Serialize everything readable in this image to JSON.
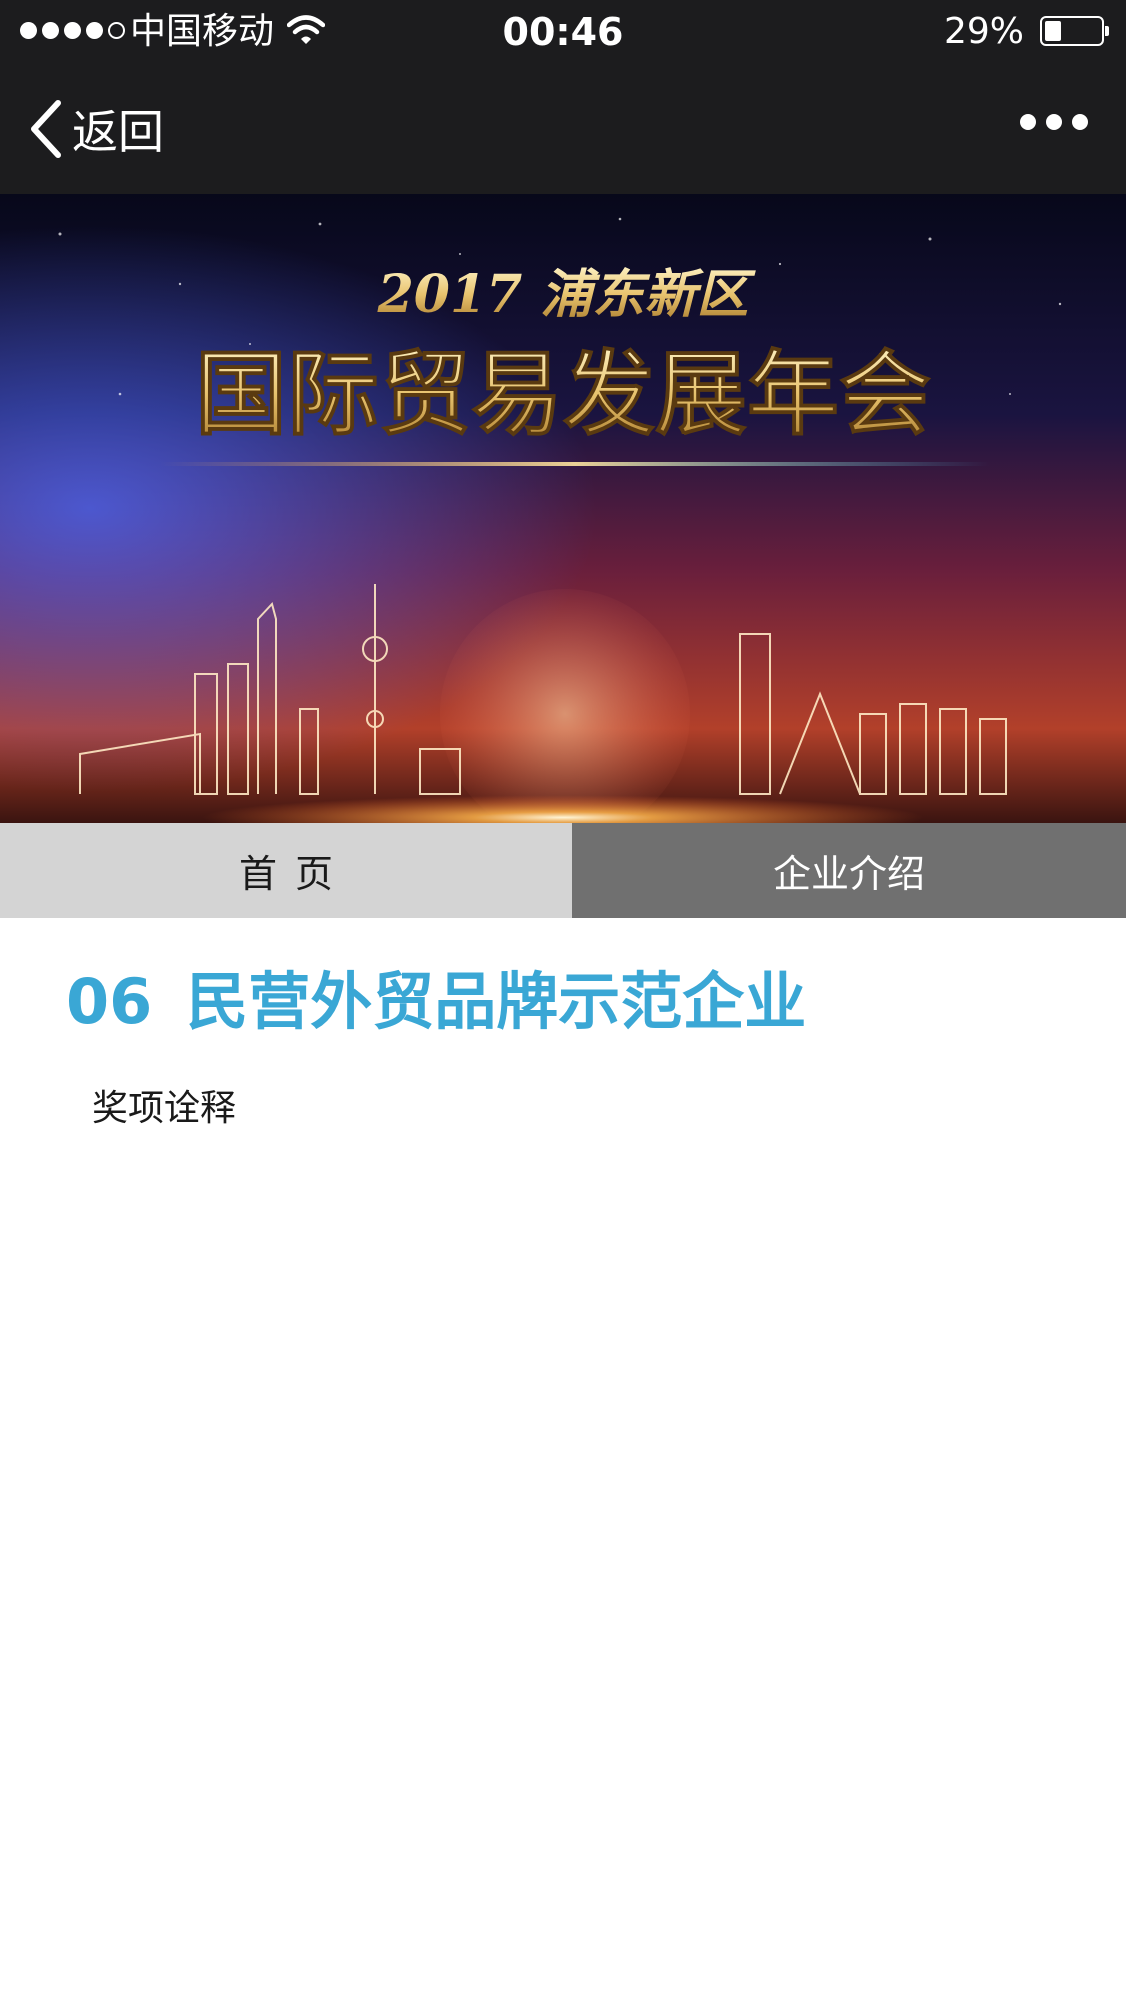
{
  "status_bar": {
    "carrier": "中国移动",
    "time": "00:46",
    "battery_percent": "29%",
    "battery_level": 0.29,
    "signal_bars_filled": 4,
    "signal_bars_total": 5
  },
  "nav": {
    "back_label": "返回",
    "more_icon": "more-dots-icon"
  },
  "banner": {
    "year_line": "2017 浦东新区",
    "title": "国际贸易发展年会"
  },
  "tabs": [
    {
      "label": "首页",
      "active": false
    },
    {
      "label": "企业介绍",
      "active": true
    }
  ],
  "section": {
    "number": "06",
    "title": "民营外贸品牌示范企业",
    "subheading": "奖项诠释"
  },
  "colors": {
    "bar_background": "#1c1c1e",
    "accent": "#3aa7d5",
    "tab_inactive": "#d4d4d4",
    "tab_active": "#707070"
  }
}
